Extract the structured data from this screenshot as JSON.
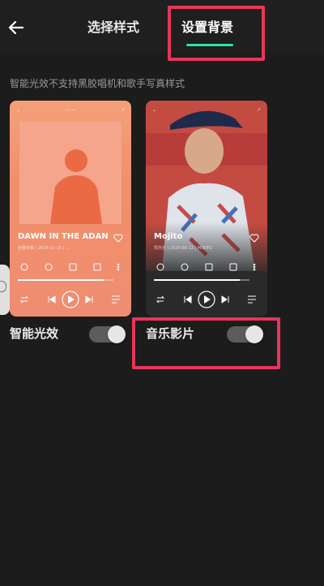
{
  "header": {
    "tabs": [
      {
        "label": "选择样式"
      },
      {
        "label": "设置背景"
      }
    ]
  },
  "notice": "智能光效不支持黑胶唱机和歌手写真样式",
  "cards": [
    {
      "title": "DAWN IN THE ADAN",
      "subtitle": "完整专辑 | 2019-11-15 | ...",
      "progress": 0.9
    },
    {
      "title": "Mojito",
      "subtitle": "周杰伦 | 2020-06-12 | MOJITO",
      "progress": 0.9
    }
  ],
  "toggles": [
    {
      "label": "智能光效",
      "on": true
    },
    {
      "label": "音乐影片",
      "on": true
    }
  ],
  "colors": {
    "accent": "#2de2a6",
    "highlight": "#e8355a",
    "background": "#1c1c1c"
  }
}
